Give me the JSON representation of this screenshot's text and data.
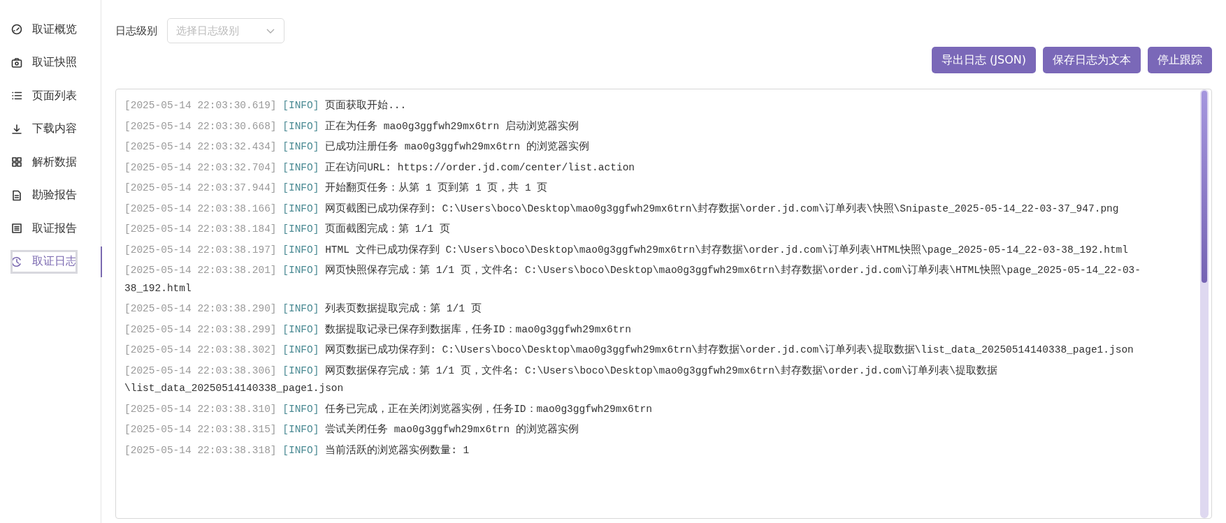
{
  "sidebar": {
    "items": [
      {
        "label": "取证概览",
        "selected": false
      },
      {
        "label": "取证快照",
        "selected": false
      },
      {
        "label": "页面列表",
        "selected": false
      },
      {
        "label": "下载内容",
        "selected": false
      },
      {
        "label": "解析数据",
        "selected": false
      },
      {
        "label": "勘验报告",
        "selected": false
      },
      {
        "label": "取证报告",
        "selected": false
      },
      {
        "label": "取证日志",
        "selected": true
      }
    ]
  },
  "filter": {
    "label": "日志级别",
    "select": {
      "placeholder": "选择日志级别"
    }
  },
  "buttons": [
    "导出日志 (JSON)",
    "保存日志为文本",
    "停止跟踪"
  ],
  "log": [
    {
      "time": "[2025-05-14 22:03:30.619]",
      "level": "[INFO]",
      "message": "页面获取开始..."
    },
    {
      "time": "[2025-05-14 22:03:30.668]",
      "level": "[INFO]",
      "message": "正在为任务 mao0g3ggfwh29mx6trn 启动浏览器实例"
    },
    {
      "time": "[2025-05-14 22:03:32.434]",
      "level": "[INFO]",
      "message": "已成功注册任务 mao0g3ggfwh29mx6trn 的浏览器实例"
    },
    {
      "time": "[2025-05-14 22:03:32.704]",
      "level": "[INFO]",
      "message": "正在访问URL: https://order.jd.com/center/list.action"
    },
    {
      "time": "[2025-05-14 22:03:37.944]",
      "level": "[INFO]",
      "message": "开始翻页任务：从第 1 页到第 1 页，共 1 页"
    },
    {
      "time": "[2025-05-14 22:03:38.166]",
      "level": "[INFO]",
      "message": "网页截图已成功保存到: C:\\Users\\boco\\Desktop\\mao0g3ggfwh29mx6trn\\封存数据\\order.jd.com\\订单列表\\快照\\Snipaste_2025-05-14_22-03-37_947.png"
    },
    {
      "time": "[2025-05-14 22:03:38.184]",
      "level": "[INFO]",
      "message": "页面截图完成：第 1/1 页"
    },
    {
      "time": "[2025-05-14 22:03:38.197]",
      "level": "[INFO]",
      "message": "HTML 文件已成功保存到 C:\\Users\\boco\\Desktop\\mao0g3ggfwh29mx6trn\\封存数据\\order.jd.com\\订单列表\\HTML快照\\page_2025-05-14_22-03-38_192.html"
    },
    {
      "time": "[2025-05-14 22:03:38.201]",
      "level": "[INFO]",
      "message": "网页快照保存完成：第 1/1 页，文件名: C:\\Users\\boco\\Desktop\\mao0g3ggfwh29mx6trn\\封存数据\\order.jd.com\\订单列表\\HTML快照\\page_2025-05-14_22-03-38_192.html"
    },
    {
      "time": "[2025-05-14 22:03:38.290]",
      "level": "[INFO]",
      "message": "列表页数据提取完成：第 1/1 页"
    },
    {
      "time": "[2025-05-14 22:03:38.299]",
      "level": "[INFO]",
      "message": "数据提取记录已保存到数据库，任务ID：mao0g3ggfwh29mx6trn"
    },
    {
      "time": "[2025-05-14 22:03:38.302]",
      "level": "[INFO]",
      "message": "网页数据已成功保存到: C:\\Users\\boco\\Desktop\\mao0g3ggfwh29mx6trn\\封存数据\\order.jd.com\\订单列表\\提取数据\\list_data_20250514140338_page1.json"
    },
    {
      "time": "[2025-05-14 22:03:38.306]",
      "level": "[INFO]",
      "message": "网页数据保存完成：第 1/1 页，文件名: C:\\Users\\boco\\Desktop\\mao0g3ggfwh29mx6trn\\封存数据\\order.jd.com\\订单列表\\提取数据\\list_data_20250514140338_page1.json"
    },
    {
      "time": "[2025-05-14 22:03:38.310]",
      "level": "[INFO]",
      "message": "任务已完成，正在关闭浏览器实例，任务ID：mao0g3ggfwh29mx6trn"
    },
    {
      "time": "[2025-05-14 22:03:38.315]",
      "level": "[INFO]",
      "message": "尝试关闭任务 mao0g3ggfwh29mx6trn 的浏览器实例"
    },
    {
      "time": "[2025-05-14 22:03:38.318]",
      "level": "[INFO]",
      "message": "当前活跃的浏览器实例数量: 1"
    }
  ]
}
